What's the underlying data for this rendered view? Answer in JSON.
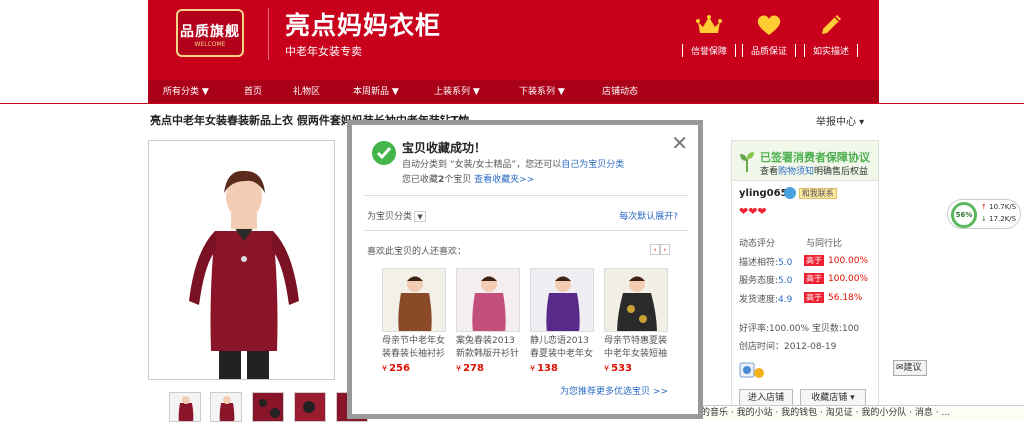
{
  "header": {
    "logo_text": "品质旗舰",
    "logo_sub": "WELCOME",
    "shop_name": "亮点妈妈衣柜",
    "shop_slogan": "中老年女装专卖",
    "badges": [
      {
        "icon": "crown-icon",
        "label": "信誉保障"
      },
      {
        "icon": "heart-icon",
        "label": "品质保证"
      },
      {
        "icon": "pencil-icon",
        "label": "如实描述"
      }
    ]
  },
  "nav": {
    "items": [
      "所有分类 ▼",
      "首页",
      "礼物区",
      "本周新品 ▼",
      "上装系列 ▼",
      "下装系列 ▼",
      "店铺动态"
    ]
  },
  "product": {
    "title": "亮点中老年女装春装新品上衣 假两件套妈妈装长袖中老年装钻T恤",
    "report_label": "举报中心 ▾"
  },
  "seller": {
    "protect_title": "已签署消费者保障协议",
    "protect_text_pre": "查看",
    "protect_link": "购物须知",
    "protect_text_post": "明确售后权益",
    "name": "yling065",
    "contact_label": "和我联系",
    "hearts": "❤❤❤",
    "rating_header": "动态评分",
    "compare_header": "与同行比",
    "ratings": [
      {
        "label": "描述相符:",
        "score": "5.0",
        "badge": "高于",
        "pct": "100.00%"
      },
      {
        "label": "服务态度:",
        "score": "5.0",
        "badge": "高于",
        "pct": "100.00%"
      },
      {
        "label": "发货速度:",
        "score": "4.9",
        "badge": "高于",
        "pct": "56.18%"
      }
    ],
    "good_rate": "好评率:100.00%  宝贝数:100",
    "created": "创店时间：2012-08-19",
    "enter_shop": "进入店铺",
    "fav_shop": "收藏店铺 ▾"
  },
  "modal": {
    "title": "宝贝收藏成功！",
    "line1_pre": "自动分类到 “女装/女士精品”，您还可以",
    "line1_link": "自己为宝贝分类",
    "line2_pre": "您已收藏",
    "line2_count": "2",
    "line2_mid": "个宝贝",
    "line2_link": "查看收藏夹>>",
    "category_label": "为宝贝分类",
    "expand_label": "每次默认展开?",
    "also_label": "喜欢此宝贝的人还喜欢：",
    "items": [
      {
        "name": "母亲节中老年女装春装长袖衬衫",
        "price": "256"
      },
      {
        "name": "案兔春装2013新款韩版开衫针织",
        "price": "278"
      },
      {
        "name": "静儿恋语2013春夏装中老年女装",
        "price": "138"
      },
      {
        "name": "母亲节特惠夏装中老年女装短袖",
        "price": "533"
      }
    ],
    "currency": "¥",
    "more_label": "为您推荐更多优选宝贝 >>"
  },
  "speed_widget": {
    "percent": "56%",
    "up": "10.7K/S",
    "down": "17.2K/S"
  },
  "suggest_label": "建议",
  "favorites_bar": "我的音乐 · 我的小站 · 我的钱包 · 淘见证 · 我的小分队 · 消息 · ..."
}
